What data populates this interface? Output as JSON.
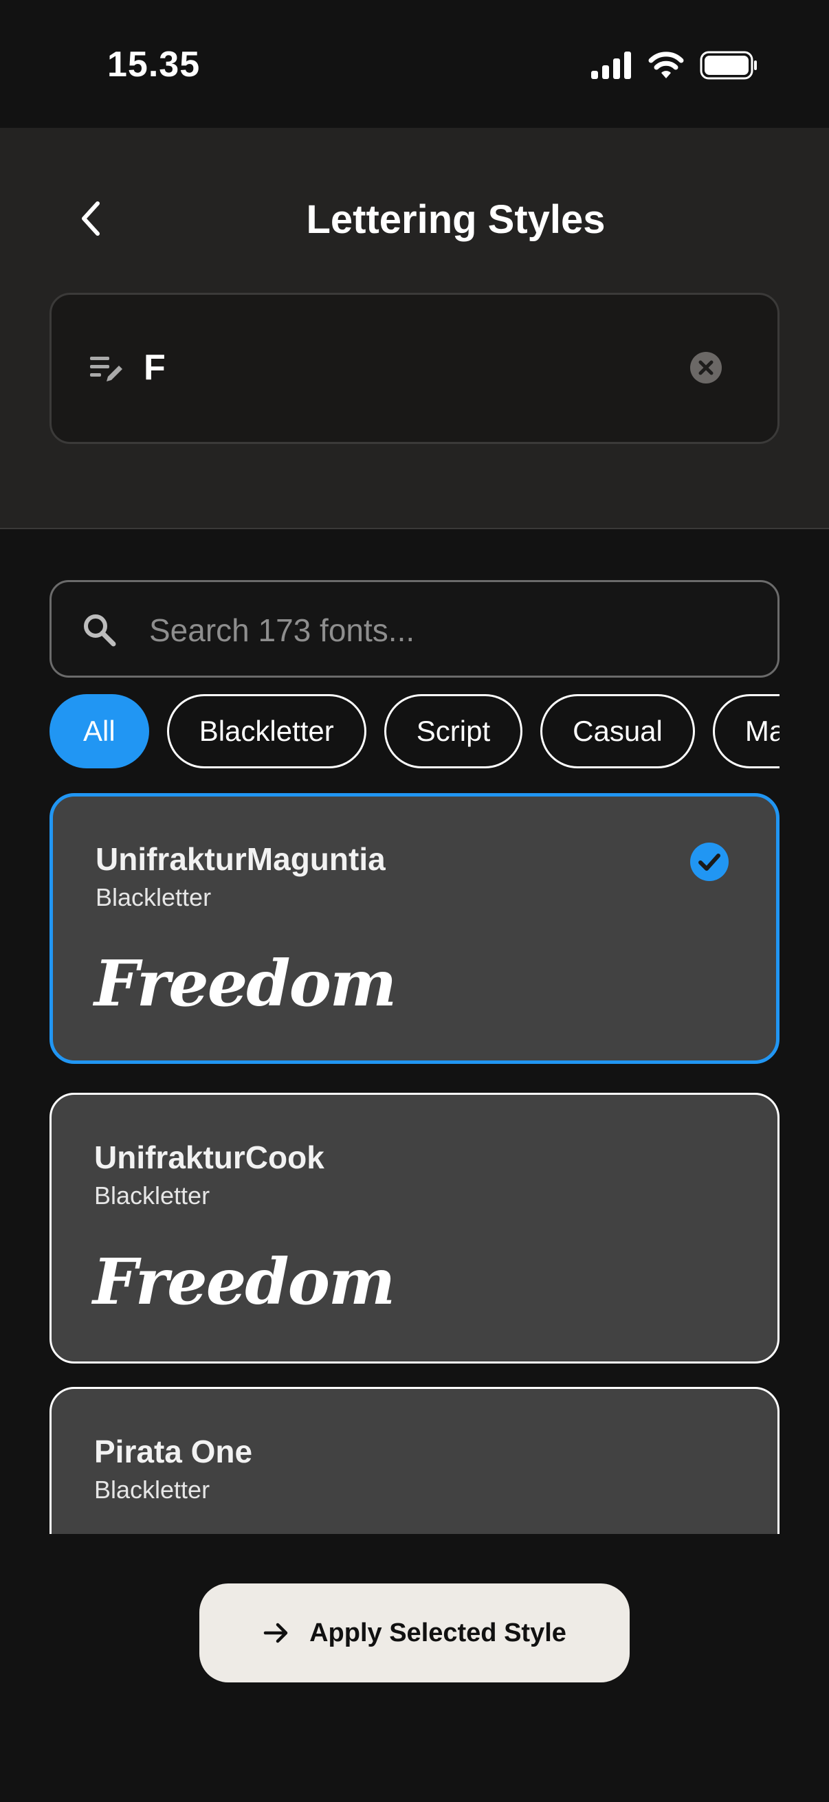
{
  "status_bar": {
    "time": "15.35",
    "signal_icon": "cellular-signal-icon",
    "wifi_icon": "wifi-icon",
    "battery_icon": "battery-icon"
  },
  "header": {
    "title": "Lettering Styles",
    "back_icon": "chevron-left-icon",
    "text_input": {
      "value": "F",
      "edit_icon": "text-edit-icon",
      "clear_icon": "clear-circle-icon"
    }
  },
  "search": {
    "placeholder": "Search 173 fonts...",
    "value": "",
    "icon": "search-icon"
  },
  "filters": {
    "active": "All",
    "chips": [
      "All",
      "Blackletter",
      "Script",
      "Casual",
      "Ma"
    ]
  },
  "fonts": [
    {
      "name": "UnifrakturMaguntia",
      "category": "Blackletter",
      "preview": "Freedom",
      "selected": true
    },
    {
      "name": "UnifrakturCook",
      "category": "Blackletter",
      "preview": "Freedom",
      "selected": false
    },
    {
      "name": "Pirata One",
      "category": "Blackletter",
      "preview": "",
      "selected": false
    }
  ],
  "apply_button": {
    "label": "Apply Selected Style",
    "icon": "arrow-right-icon"
  },
  "colors": {
    "accent": "#2196F3",
    "card_bg": "#424242",
    "header_bg": "#242322",
    "page_bg": "#121212",
    "button_bg": "#EEEBE6"
  }
}
